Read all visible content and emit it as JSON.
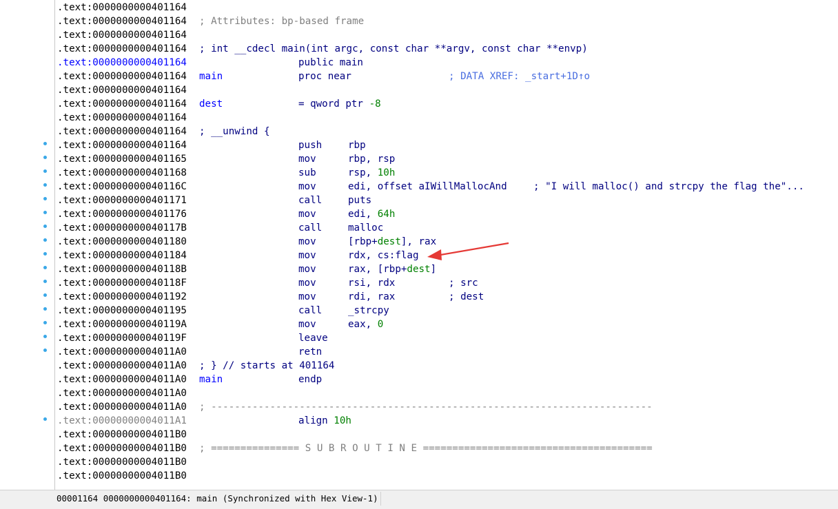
{
  "listing": {
    "lines": [
      {
        "addr": ".text:0000000000401164"
      },
      {
        "addr": ".text:0000000000401164",
        "comment": "; Attributes: bp-based frame",
        "comment_style": "gray"
      },
      {
        "addr": ".text:0000000000401164"
      },
      {
        "addr": ".text:0000000000401164",
        "comment": "; int __cdecl main(int argc, const char **argv, const char **envp)"
      },
      {
        "addr": ".text:0000000000401164",
        "addr_style": "blue",
        "mnemonic": "public main"
      },
      {
        "addr": ".text:0000000000401164",
        "label": "main",
        "mnemonic": "proc near",
        "xref": "; DATA XREF: _start+1D↑o"
      },
      {
        "addr": ".text:0000000000401164"
      },
      {
        "addr": ".text:0000000000401164",
        "label": "dest",
        "mnemonic": "= qword ptr",
        "imm": "-8"
      },
      {
        "addr": ".text:0000000000401164"
      },
      {
        "addr": ".text:0000000000401164",
        "comment": "; __unwind {"
      },
      {
        "addr": ".text:0000000000401164",
        "dot": true,
        "mnemonic": "push",
        "operands": "rbp"
      },
      {
        "addr": ".text:0000000000401165",
        "dot": true,
        "mnemonic": "mov",
        "operands": "rbp, rsp"
      },
      {
        "addr": ".text:0000000000401168",
        "dot": true,
        "mnemonic": "sub",
        "operands": "rsp,",
        "imm": "10h"
      },
      {
        "addr": ".text:000000000040116C",
        "dot": true,
        "mnemonic": "mov",
        "operands": "edi, offset aIWillMallocAnd",
        "trail": "; \"I will malloc() and strcpy the flag the\"..."
      },
      {
        "addr": ".text:0000000000401171",
        "dot": true,
        "mnemonic": "call",
        "operands": "puts"
      },
      {
        "addr": ".text:0000000000401176",
        "dot": true,
        "mnemonic": "mov",
        "operands": "edi,",
        "imm": "64h"
      },
      {
        "addr": ".text:000000000040117B",
        "dot": true,
        "mnemonic": "call",
        "operands": "malloc"
      },
      {
        "addr": ".text:0000000000401180",
        "dot": true,
        "mnemonic": "mov",
        "operands_rich": [
          [
            "[rbp+",
            "n"
          ],
          [
            "dest",
            "g"
          ],
          [
            "], rax",
            "n"
          ]
        ]
      },
      {
        "addr": ".text:0000000000401184",
        "dot": true,
        "mnemonic": "mov",
        "operands": "rdx, cs:flag"
      },
      {
        "addr": ".text:000000000040118B",
        "dot": true,
        "mnemonic": "mov",
        "operands_rich": [
          [
            "rax, [rbp+",
            "n"
          ],
          [
            "dest",
            "g"
          ],
          [
            "]",
            "n"
          ]
        ]
      },
      {
        "addr": ".text:000000000040118F",
        "dot": true,
        "mnemonic": "mov",
        "operands": "rsi, rdx",
        "trail": "; src"
      },
      {
        "addr": ".text:0000000000401192",
        "dot": true,
        "mnemonic": "mov",
        "operands": "rdi, rax",
        "trail": "; dest"
      },
      {
        "addr": ".text:0000000000401195",
        "dot": true,
        "mnemonic": "call",
        "operands": "_strcpy"
      },
      {
        "addr": ".text:000000000040119A",
        "dot": true,
        "mnemonic": "mov",
        "operands": "eax,",
        "imm": "0"
      },
      {
        "addr": ".text:000000000040119F",
        "dot": true,
        "mnemonic": "leave"
      },
      {
        "addr": ".text:00000000004011A0",
        "dot": true,
        "mnemonic": "retn"
      },
      {
        "addr": ".text:00000000004011A0",
        "comment": "; } // starts at 401164"
      },
      {
        "addr": ".text:00000000004011A0",
        "label": "main",
        "mnemonic": "endp"
      },
      {
        "addr": ".text:00000000004011A0"
      },
      {
        "addr": ".text:00000000004011A0",
        "comment": "; ---------------------------------------------------------------------------",
        "comment_style": "gray"
      },
      {
        "addr": ".text:00000000004011A1",
        "addr_style": "gray",
        "dot": true,
        "mnemonic": "align",
        "imm": "10h"
      },
      {
        "addr": ".text:00000000004011B0"
      },
      {
        "addr": ".text:00000000004011B0",
        "comment": "; =============== S U B R O U T I N E =======================================",
        "comment_style": "gray"
      },
      {
        "addr": ".text:00000000004011B0"
      },
      {
        "addr": ".text:00000000004011B0"
      }
    ]
  },
  "status_bar": {
    "text": "00001164 0000000000401164: main (Synchronized with Hex View-1)"
  },
  "colors": {
    "arrow": "#e53935",
    "address_dot": "#3aa8e8"
  }
}
